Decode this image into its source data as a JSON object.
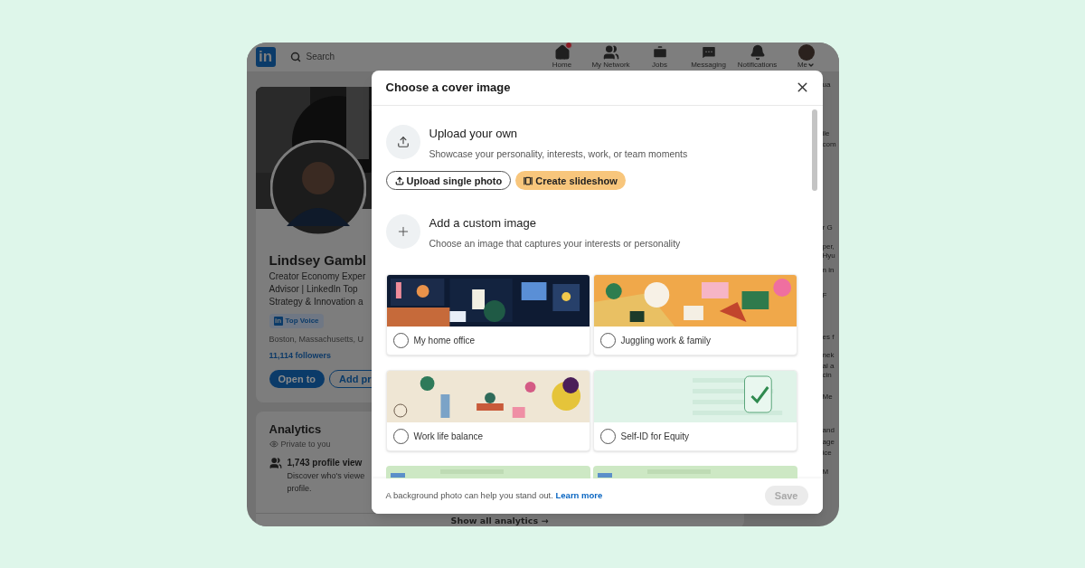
{
  "nav": {
    "logo": "in",
    "search": {
      "placeholder": "Search"
    },
    "items": [
      {
        "label": "Home",
        "badge": true
      },
      {
        "label": "My Network",
        "badge": false
      },
      {
        "label": "Jobs",
        "badge": false
      },
      {
        "label": "Messaging",
        "badge": false
      },
      {
        "label": "Notifications",
        "badge": false
      },
      {
        "label": "Me",
        "badge": false
      }
    ]
  },
  "profile": {
    "name": "Lindsey Gambl",
    "headline": [
      "Creator Economy Exper",
      "Advisor | LinkedIn Top",
      "Strategy & Innovation a"
    ],
    "badge": {
      "logo": "in",
      "label": "Top Voice"
    },
    "location": "Boston, Massachusetts, U",
    "followers": "11,114 followers",
    "buttons": [
      {
        "label": "Open to",
        "kind": "primary"
      },
      {
        "label": "Add pr",
        "kind": "outline"
      }
    ]
  },
  "analytics": {
    "title": "Analytics",
    "privacy": "Private to you",
    "stat": {
      "title": "1,743 profile view",
      "lines": [
        "Discover who's viewe",
        "profile."
      ]
    },
    "footer": "Show all analytics →"
  },
  "right_rail": [
    "ua",
    "ile",
    "com",
    "r G",
    "per,",
    "Hyu",
    "n in",
    "F",
    "es f",
    "nek",
    "al a",
    "cin",
    "Me",
    "and",
    "age",
    "ice",
    "M"
  ],
  "modal": {
    "title": "Choose a cover image",
    "upload": {
      "title": "Upload your own",
      "subtitle": "Showcase your personality, interests, work, or team moments",
      "buttons": [
        {
          "label": "Upload single photo",
          "kind": "outline"
        },
        {
          "label": "Create slideshow",
          "kind": "highlight"
        }
      ]
    },
    "custom": {
      "title": "Add a custom image",
      "subtitle": "Choose an image that captures your interests or personality"
    },
    "options": [
      {
        "label": "My home office",
        "selected": false,
        "kind": "office"
      },
      {
        "label": "Juggling work & family",
        "selected": false,
        "kind": "juggling"
      },
      {
        "label": "Work life balance",
        "selected": false,
        "kind": "balance"
      },
      {
        "label": "Self-ID for Equity",
        "selected": false,
        "kind": "equity"
      }
    ],
    "footer": {
      "text": "A background photo can help you stand out.",
      "link": "Learn more",
      "save": {
        "label": "Save",
        "disabled": true
      }
    }
  }
}
